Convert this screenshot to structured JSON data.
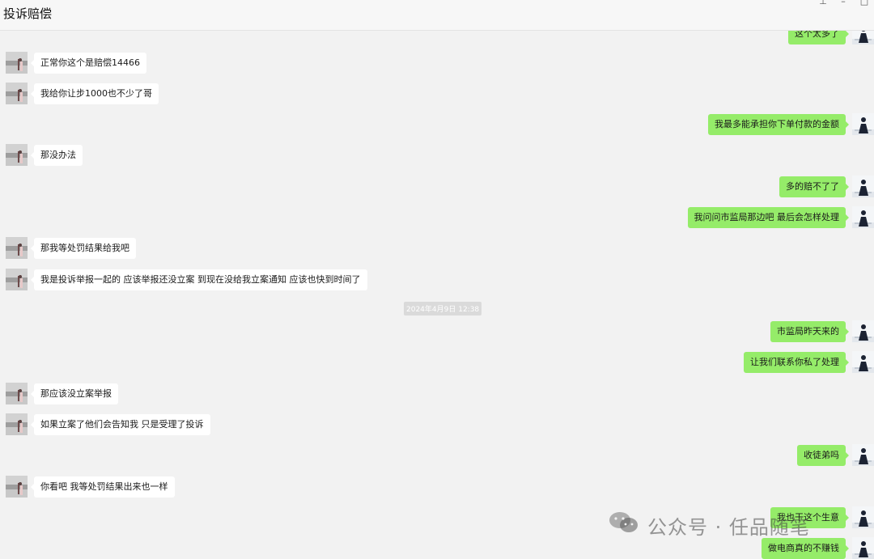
{
  "window": {
    "title": "投诉赔偿",
    "controls": {
      "pin": "⊥",
      "minimize": "–",
      "maximize": "□"
    }
  },
  "colors": {
    "sent_bubble": "#95ec69",
    "received_bubble": "#ffffff",
    "background": "#f2f2f2"
  },
  "messages": [
    {
      "side": "right",
      "text": "这个太多了",
      "partial": true
    },
    {
      "side": "left",
      "text": "正常你这个是赔偿14466"
    },
    {
      "side": "left",
      "text": "我给你让步1000也不少了哥"
    },
    {
      "side": "right",
      "text": "我最多能承担你下单付款的金额"
    },
    {
      "side": "left",
      "text": "那没办法"
    },
    {
      "side": "right",
      "text": "多的赔不了了"
    },
    {
      "side": "right",
      "text": "我问问市监局那边吧 最后会怎样处理"
    },
    {
      "side": "left",
      "text": "那我等处罚结果给我吧"
    },
    {
      "side": "left",
      "text": "我是投诉举报一起的  应该举报还没立案 到现在没给我立案通知  应该也快到时间了"
    },
    {
      "side": "right",
      "text": "市监局昨天来的"
    },
    {
      "side": "right",
      "text": "让我们联系你私了处理"
    },
    {
      "side": "left",
      "text": "那应该没立案举报"
    },
    {
      "side": "left",
      "text": "如果立案了他们会告知我  只是受理了投诉"
    },
    {
      "side": "right",
      "text": "收徒弟吗"
    },
    {
      "side": "left",
      "text": "你看吧  我等处罚结果出来也一样"
    },
    {
      "side": "right",
      "text": "我也干这个生意"
    },
    {
      "side": "right",
      "text": "做电商真的不赚钱"
    }
  ],
  "timestamp": "2024年4月9日 12:38",
  "watermark": {
    "icon": "wechat-icon",
    "text": "公众号 · 任品随笔"
  }
}
